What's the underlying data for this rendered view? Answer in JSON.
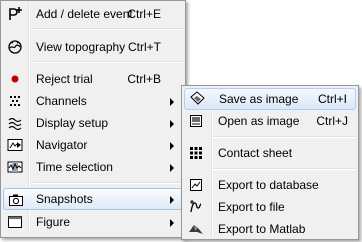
{
  "main_menu": {
    "items": [
      {
        "label": "Add / delete event",
        "shortcut": "Ctrl+E",
        "icon": "add-event-icon"
      },
      {
        "label": "View topography",
        "shortcut": "Ctrl+T",
        "icon": "topography-icon"
      },
      {
        "label": "Reject trial",
        "shortcut": "Ctrl+B",
        "icon": "red-dot-icon"
      },
      {
        "label": "Channels",
        "icon": "channels-icon"
      },
      {
        "label": "Display setup",
        "icon": "display-setup-icon"
      },
      {
        "label": "Navigator",
        "icon": "navigator-icon"
      },
      {
        "label": "Time selection",
        "icon": "time-selection-icon"
      },
      {
        "label": "Snapshots",
        "icon": "camera-icon"
      },
      {
        "label": "Figure",
        "icon": "figure-icon"
      }
    ]
  },
  "sub_menu": {
    "items": [
      {
        "label": "Save as image",
        "shortcut": "Ctrl+I",
        "icon": "save-image-icon"
      },
      {
        "label": "Open as image",
        "shortcut": "Ctrl+J",
        "icon": "open-image-icon"
      },
      {
        "label": "Contact sheet",
        "icon": "contact-sheet-icon"
      },
      {
        "label": "Export to database",
        "icon": "export-database-icon"
      },
      {
        "label": "Export to file",
        "icon": "export-file-icon"
      },
      {
        "label": "Export to Matlab",
        "icon": "export-matlab-icon"
      }
    ]
  },
  "colors": {
    "menu_bg": "#f0f0f0",
    "highlight_border": "#a8c4eb",
    "reject_dot": "#c00000"
  }
}
